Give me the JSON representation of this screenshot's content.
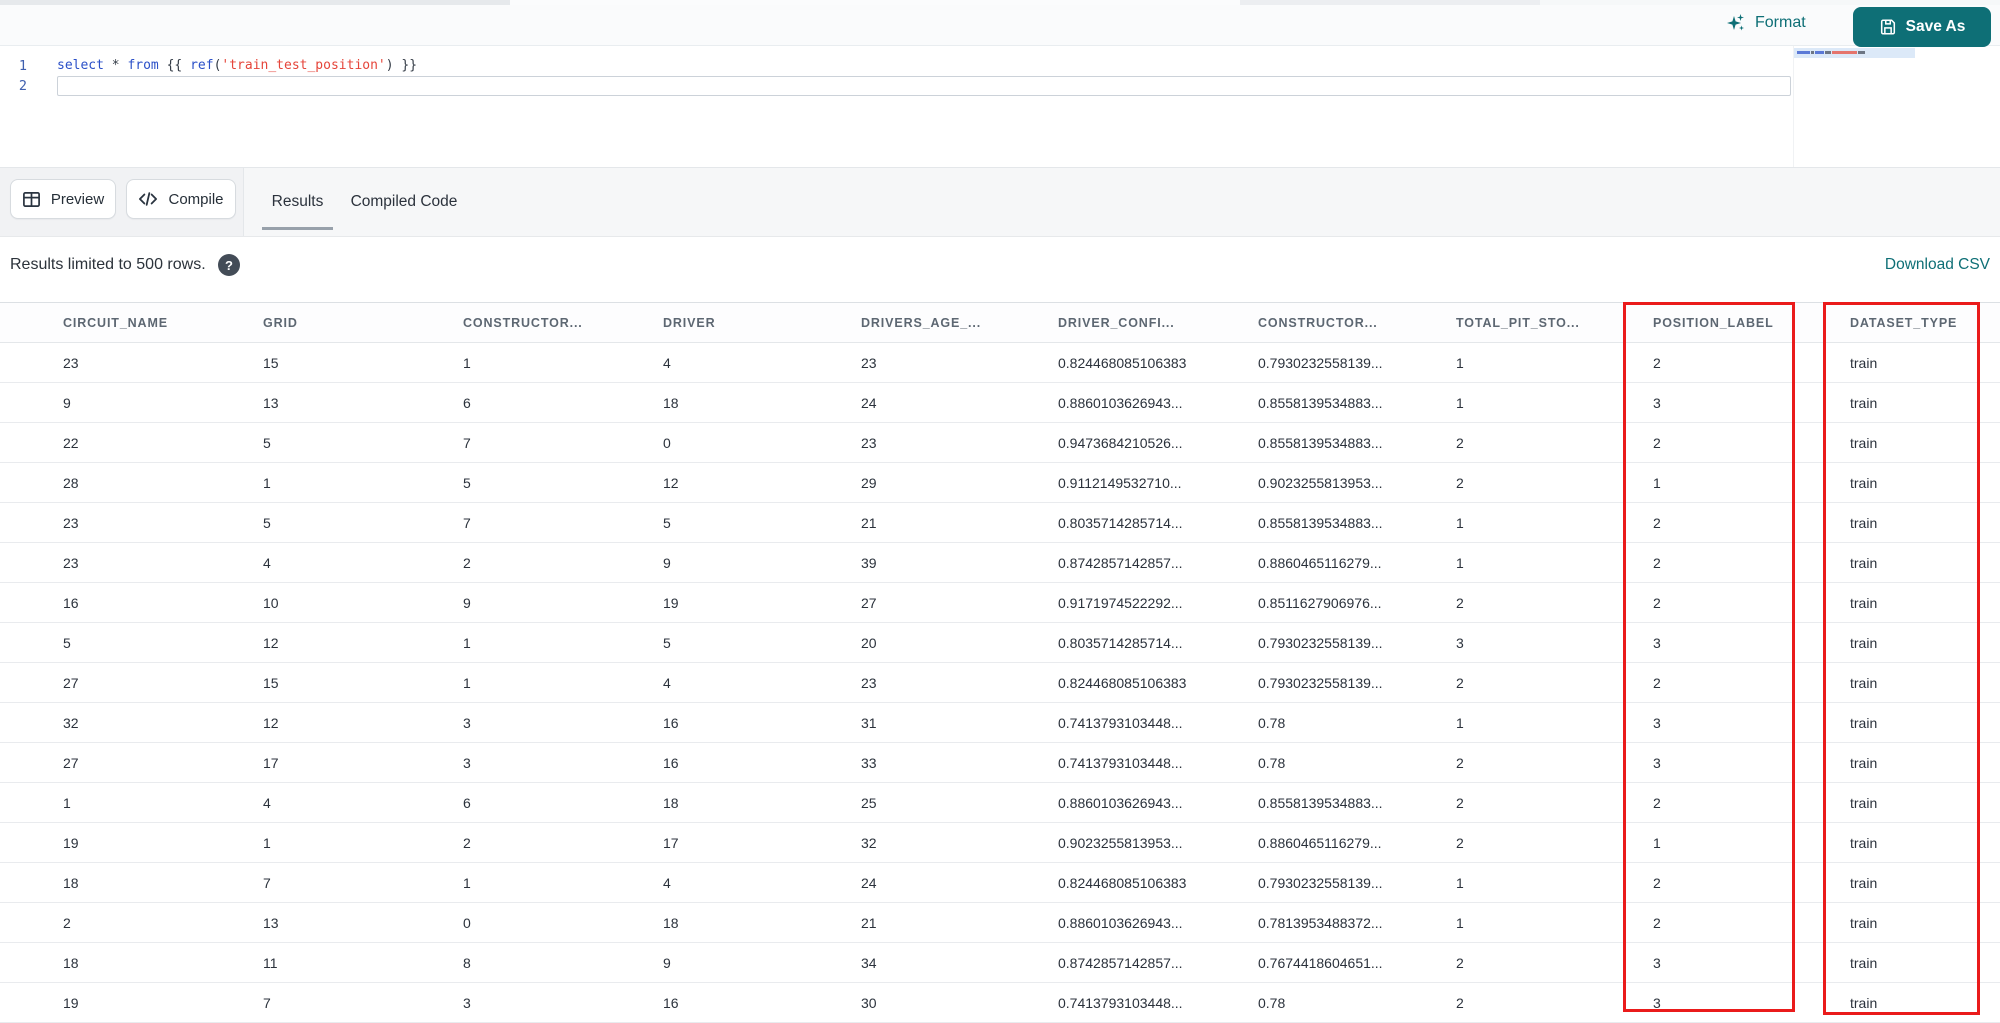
{
  "header": {
    "format_label": "Format",
    "save_as_label": "Save As"
  },
  "editor": {
    "line_numbers": [
      "1",
      "2"
    ],
    "code_line": {
      "text": "select * from {{ ref('train_test_position') }}",
      "tokens": [
        {
          "text": "select",
          "type": "keyword"
        },
        {
          "text": " ",
          "type": "plain"
        },
        {
          "text": "*",
          "type": "operator"
        },
        {
          "text": " ",
          "type": "plain"
        },
        {
          "text": "from",
          "type": "keyword"
        },
        {
          "text": " {{ ",
          "type": "plain"
        },
        {
          "text": "ref",
          "type": "keyword"
        },
        {
          "text": "(",
          "type": "plain"
        },
        {
          "text": "'train_test_position'",
          "type": "string"
        },
        {
          "text": ") }}",
          "type": "plain"
        }
      ]
    }
  },
  "toolbar": {
    "preview_label": "Preview",
    "compile_label": "Compile",
    "tabs": [
      {
        "label": "Results",
        "active": true
      },
      {
        "label": "Compiled Code",
        "active": false
      }
    ]
  },
  "results": {
    "limit_note": "Results limited to 500 rows.",
    "help_icon_glyph": "?",
    "download_label": "Download CSV"
  },
  "table": {
    "columns": [
      "CIRCUIT_NAME",
      "GRID",
      "CONSTRUCTOR...",
      "DRIVER",
      "DRIVERS_AGE_...",
      "DRIVER_CONFI...",
      "CONSTRUCTOR...",
      "TOTAL_PIT_STO...",
      "POSITION_LABEL",
      "DATASET_TYPE"
    ],
    "rows": [
      [
        "23",
        "15",
        "1",
        "4",
        "23",
        "0.824468085106383",
        "0.7930232558139...",
        "1",
        "2",
        "train"
      ],
      [
        "9",
        "13",
        "6",
        "18",
        "24",
        "0.8860103626943...",
        "0.8558139534883...",
        "1",
        "3",
        "train"
      ],
      [
        "22",
        "5",
        "7",
        "0",
        "23",
        "0.9473684210526...",
        "0.8558139534883...",
        "2",
        "2",
        "train"
      ],
      [
        "28",
        "1",
        "5",
        "12",
        "29",
        "0.9112149532710...",
        "0.9023255813953...",
        "2",
        "1",
        "train"
      ],
      [
        "23",
        "5",
        "7",
        "5",
        "21",
        "0.8035714285714...",
        "0.8558139534883...",
        "1",
        "2",
        "train"
      ],
      [
        "23",
        "4",
        "2",
        "9",
        "39",
        "0.8742857142857...",
        "0.8860465116279...",
        "1",
        "2",
        "train"
      ],
      [
        "16",
        "10",
        "9",
        "19",
        "27",
        "0.9171974522292...",
        "0.8511627906976...",
        "2",
        "2",
        "train"
      ],
      [
        "5",
        "12",
        "1",
        "5",
        "20",
        "0.8035714285714...",
        "0.7930232558139...",
        "3",
        "3",
        "train"
      ],
      [
        "27",
        "15",
        "1",
        "4",
        "23",
        "0.824468085106383",
        "0.7930232558139...",
        "2",
        "2",
        "train"
      ],
      [
        "32",
        "12",
        "3",
        "16",
        "31",
        "0.7413793103448...",
        "0.78",
        "1",
        "3",
        "train"
      ],
      [
        "27",
        "17",
        "3",
        "16",
        "33",
        "0.7413793103448...",
        "0.78",
        "2",
        "3",
        "train"
      ],
      [
        "1",
        "4",
        "6",
        "18",
        "25",
        "0.8860103626943...",
        "0.8558139534883...",
        "2",
        "2",
        "train"
      ],
      [
        "19",
        "1",
        "2",
        "17",
        "32",
        "0.9023255813953...",
        "0.8860465116279...",
        "2",
        "1",
        "train"
      ],
      [
        "18",
        "7",
        "1",
        "4",
        "24",
        "0.824468085106383",
        "0.7930232558139...",
        "1",
        "2",
        "train"
      ],
      [
        "2",
        "13",
        "0",
        "18",
        "21",
        "0.8860103626943...",
        "0.7813953488372...",
        "1",
        "2",
        "train"
      ],
      [
        "18",
        "11",
        "8",
        "9",
        "34",
        "0.8742857142857...",
        "0.7674418604651...",
        "2",
        "3",
        "train"
      ],
      [
        "19",
        "7",
        "3",
        "16",
        "30",
        "0.7413793103448...",
        "0.78",
        "2",
        "3",
        "train"
      ]
    ]
  },
  "annotations": {
    "highlight_color": "#ea1b1b",
    "highlighted_columns": [
      "POSITION_LABEL",
      "DATASET_TYPE"
    ]
  },
  "colors": {
    "accent_teal": "#0e6f76",
    "keyword_blue": "#2b50c8",
    "string_red": "#e5453a",
    "highlight_red": "#ea1b1b"
  }
}
